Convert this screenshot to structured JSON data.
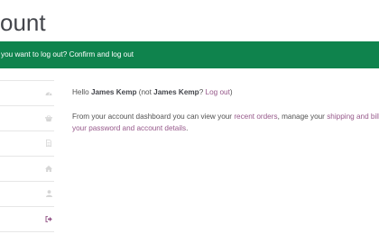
{
  "page": {
    "title": "ount"
  },
  "notice": {
    "text": "you want to log out?",
    "link": "Confirm and log out",
    "bg_color": "#0f834d"
  },
  "nav": {
    "items": [
      {
        "icon": "dashboard-icon",
        "active": false
      },
      {
        "icon": "basket-icon",
        "active": false
      },
      {
        "icon": "file-icon",
        "active": false
      },
      {
        "icon": "home-icon",
        "active": false
      },
      {
        "icon": "user-icon",
        "active": false
      },
      {
        "icon": "sign-out-icon",
        "active": true
      }
    ],
    "icon_color": "#d0d0d0",
    "active_icon_color": "#96588a"
  },
  "content": {
    "hello": "Hello",
    "user_name": "James Kemp",
    "not_prefix": "(not",
    "not_user": "James Kemp",
    "not_suffix": "?",
    "logout_link": "Log out",
    "logout_close": ")",
    "intro": "From your account dashboard you can view your",
    "recent_orders": "recent orders",
    "manage": ", manage your",
    "addresses_link": "shipping and billing add",
    "edit_link": "your password and account details",
    "period": ".",
    "link_color": "#96588a"
  }
}
